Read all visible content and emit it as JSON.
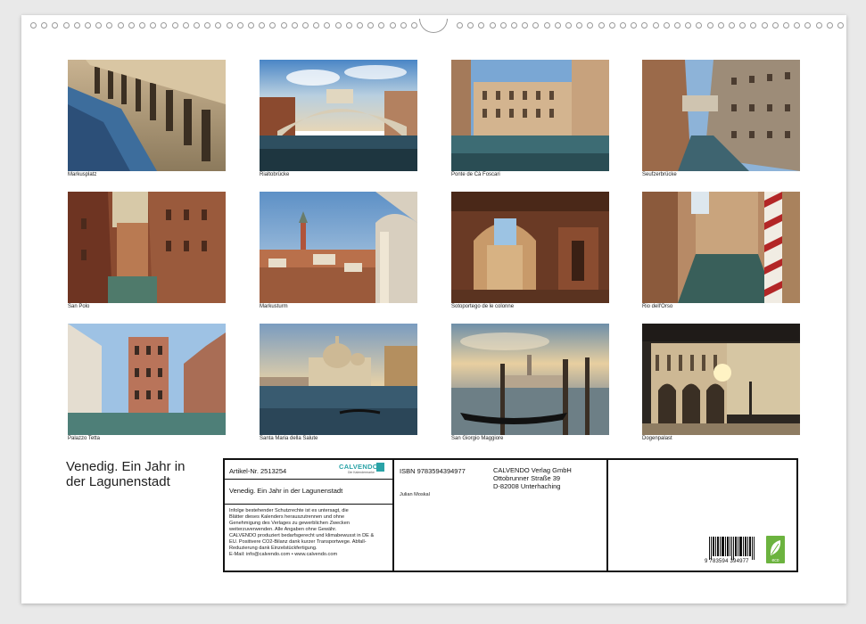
{
  "calendar_title": [
    "Venedig. Ein Jahr in",
    "der Lagunenstadt"
  ],
  "photos": [
    {
      "caption": "Markusplatz"
    },
    {
      "caption": "Rialtobrücke"
    },
    {
      "caption": "Ponte de Cà Foscari"
    },
    {
      "caption": "Seufzerbrücke"
    },
    {
      "caption": "San Polo"
    },
    {
      "caption": "Markusturm"
    },
    {
      "caption": "Sotoportego de le colonne"
    },
    {
      "caption": "Rio dell'Orso"
    },
    {
      "caption": "Palazzo Tetta"
    },
    {
      "caption": "Santa Maria della Salute"
    },
    {
      "caption": "San Giorgio Maggiore"
    },
    {
      "caption": "Dogenpalast"
    }
  ],
  "info": {
    "article": "Artikel-Nr. 2513254",
    "publisher_logo": "CALVENDO",
    "publisher_logo_tagline": "Die Kalendermarke",
    "product_title": "Venedig. Ein Jahr in der Lagunenstadt",
    "legal_lines": [
      "Infolge bestehender Schutzrechte ist es untersagt, die",
      "Blätter dieses Kalenders herauszutrennen und ohne",
      "Genehmigung des Verlages zu gewerblichen Zwecken",
      "weiterzuverwenden. Alle Angaben ohne Gewähr.",
      "CALVENDO produziert bedarfsgerecht und klimabewusst in DE &",
      "EU. Positivere CO2-Bilanz dank kurzer Transportwege. Abfall-",
      "Reduzierung dank Einzelstückfertigung.",
      "E-Mail: info@calvendo.com • www.calvendo.com"
    ],
    "isbn": "ISBN 9783594394977",
    "author": "Julian Moskal",
    "publisher_lines": [
      "CALVENDO Verlag GmbH",
      "Ottobrunner Straße 39",
      "D-82008 Unterhaching"
    ],
    "barcode_number": "9 783594 394977",
    "eco_label": "eco"
  }
}
